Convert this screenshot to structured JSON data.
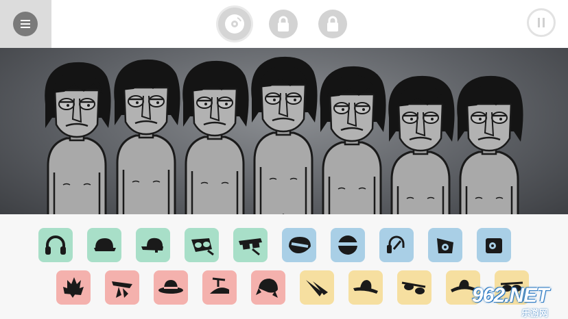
{
  "toolbar": {
    "menu_icon": "hamburger-icon",
    "buttons": [
      {
        "name": "bonus-disc-button",
        "icon": "disc-icon",
        "state": "available"
      },
      {
        "name": "bonus-lock-1",
        "icon": "lock-icon",
        "state": "locked"
      },
      {
        "name": "bonus-lock-2",
        "icon": "lock-icon",
        "state": "locked"
      }
    ],
    "pause_icon": "pause-icon"
  },
  "stage": {
    "performers": 7
  },
  "sound_icons": {
    "row1": [
      {
        "category": "beats",
        "icon": "headphones-icon",
        "color": "#a8dfc8"
      },
      {
        "category": "beats",
        "icon": "cap-icon",
        "color": "#a8dfc8"
      },
      {
        "category": "beats",
        "icon": "cap-icon",
        "color": "#a8dfc8"
      },
      {
        "category": "beats",
        "icon": "goggles-icon",
        "color": "#a8dfc8"
      },
      {
        "category": "beats",
        "icon": "3d-glasses-icon",
        "color": "#a8dfc8"
      },
      {
        "category": "effects",
        "icon": "visor-icon",
        "color": "#a9cfe6"
      },
      {
        "category": "effects",
        "icon": "mask-icon",
        "color": "#a9cfe6"
      },
      {
        "category": "effects",
        "icon": "headset-icon",
        "color": "#a9cfe6"
      },
      {
        "category": "effects",
        "icon": "speaker-icon",
        "color": "#a9cfe6"
      },
      {
        "category": "effects",
        "icon": "radio-icon",
        "color": "#a9cfe6"
      }
    ],
    "row2": [
      {
        "category": "melodies",
        "icon": "spiky-hair-icon",
        "color": "#f4b1ad"
      },
      {
        "category": "melodies",
        "icon": "scarf-icon",
        "color": "#f4b1ad"
      },
      {
        "category": "melodies",
        "icon": "fedora-icon",
        "color": "#f4b1ad"
      },
      {
        "category": "melodies",
        "icon": "propeller-hat-icon",
        "color": "#f4b1ad"
      },
      {
        "category": "melodies",
        "icon": "bandana-icon",
        "color": "#f4b1ad"
      },
      {
        "category": "voices",
        "icon": "feather-icon",
        "color": "#f6dfa0"
      },
      {
        "category": "voices",
        "icon": "straw-hat-icon",
        "color": "#f6dfa0"
      },
      {
        "category": "voices",
        "icon": "sunglasses-icon",
        "color": "#f6dfa0"
      },
      {
        "category": "voices",
        "icon": "sombrero-icon",
        "color": "#f6dfa0"
      },
      {
        "category": "voices",
        "icon": "glasses-icon",
        "color": "#f6dfa0"
      }
    ]
  },
  "watermark": {
    "main": "962.NET",
    "sub": "乐游网"
  }
}
